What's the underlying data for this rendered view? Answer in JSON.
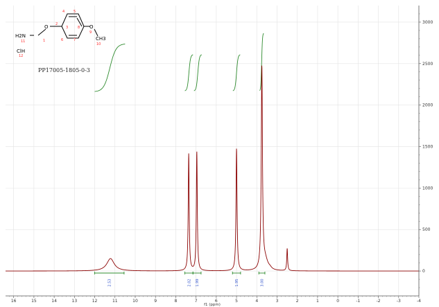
{
  "chart_data": {
    "type": "line",
    "title": "",
    "sample_id": "PP17005-1805-0-3",
    "xlabel": "f1 (ppm)",
    "ylabel": "",
    "x_reversed": true,
    "xlim": [
      16.4,
      -4.0
    ],
    "ylim": [
      -300,
      3200
    ],
    "x_ticks": [
      "16",
      "15",
      "14",
      "13",
      "12",
      "11",
      "10",
      "9",
      "8",
      "7",
      "6",
      "5",
      "4",
      "3",
      "2",
      "1",
      "0",
      "-1",
      "-2",
      "-3",
      "-4"
    ],
    "y_ticks": [
      "0",
      "500",
      "1000",
      "1500",
      "2000",
      "2500",
      "3000"
    ],
    "grid": true,
    "spectrum_color": "#8b0000",
    "integral_color": "#2e8b2e",
    "integral_label_color": "#3355cc",
    "peaks": [
      {
        "shift": 11.22,
        "height": 150,
        "width": 0.22
      },
      {
        "shift": 7.36,
        "height": 1410,
        "width": 0.028
      },
      {
        "shift": 6.96,
        "height": 1435,
        "width": 0.028
      },
      {
        "shift": 5.0,
        "height": 1475,
        "width": 0.03
      },
      {
        "shift": 3.75,
        "height": 2430,
        "width": 0.035
      },
      {
        "shift": 3.58,
        "height": 120,
        "width": 0.15
      },
      {
        "shift": 2.5,
        "height": 270,
        "width": 0.025
      },
      {
        "shift": 3.35,
        "height": 18,
        "width": 0.1
      }
    ],
    "integrals": [
      {
        "from": 12.0,
        "to": 10.55,
        "label": "2.53"
      },
      {
        "from": 7.55,
        "to": 7.15,
        "label": "2.02"
      },
      {
        "from": 7.15,
        "to": 6.75,
        "label": "1.99"
      },
      {
        "from": 5.2,
        "to": 4.8,
        "label": "1.95"
      },
      {
        "from": 3.9,
        "to": 3.6,
        "label": "3.00"
      }
    ],
    "structure": {
      "atoms": [
        "H2N",
        "O",
        "O",
        "CH3",
        "ClH"
      ],
      "atom_numbers": [
        "1",
        "2",
        "3",
        "4",
        "5",
        "6",
        "7",
        "8",
        "9",
        "10",
        "11",
        "12"
      ]
    }
  }
}
